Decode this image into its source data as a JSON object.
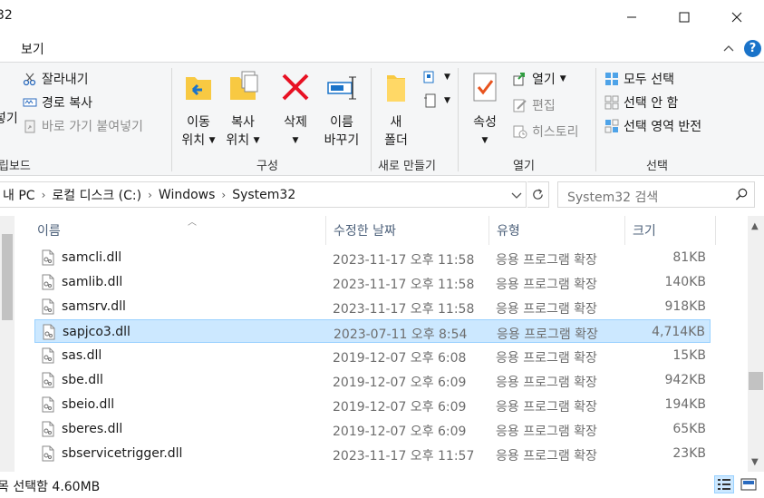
{
  "window": {
    "title": "32",
    "minimize_glyph": "—",
    "maximize_glyph": "☐",
    "close_glyph": "✕"
  },
  "ribbon_tabs": {
    "view_label": "보기",
    "help_glyph": "?"
  },
  "ribbon": {
    "clipboard": {
      "partial_label_left": "넣기",
      "cut_label": "잘라내기",
      "copy_path_label": "경로 복사",
      "paste_shortcut_label": "바로 가기 붙여넣기",
      "group_label": "립보드"
    },
    "organize": {
      "move_to_line1": "이동",
      "move_to_line2": "위치",
      "copy_to_line1": "복사",
      "copy_to_line2": "위치",
      "delete_label": "삭제",
      "rename_line1": "이름",
      "rename_line2": "바꾸기",
      "group_label": "구성"
    },
    "new": {
      "new_folder_line1": "새",
      "new_folder_line2": "폴더",
      "group_label": "새로 만들기"
    },
    "open": {
      "properties_label": "속성",
      "open_label": "열기",
      "edit_label": "편집",
      "history_label": "히스토리",
      "group_label": "열기"
    },
    "select": {
      "select_all_label": "모두 선택",
      "select_none_label": "선택 안 함",
      "invert_selection_label": "선택 영역 반전",
      "group_label": "선택"
    }
  },
  "address_bar": {
    "breadcrumbs": [
      "내 PC",
      "로컬 디스크 (C:)",
      "Windows",
      "System32"
    ],
    "search_placeholder": "System32 검색"
  },
  "file_list": {
    "columns": {
      "name": "이름",
      "date": "수정한 날짜",
      "type": "유형",
      "size": "크기"
    },
    "rows": [
      {
        "name": "samcli.dll",
        "date": "2023-11-17 오후 11:58",
        "type": "응용 프로그램 확장",
        "size": "81KB"
      },
      {
        "name": "samlib.dll",
        "date": "2023-11-17 오후 11:58",
        "type": "응용 프로그램 확장",
        "size": "140KB"
      },
      {
        "name": "samsrv.dll",
        "date": "2023-11-17 오후 11:58",
        "type": "응용 프로그램 확장",
        "size": "918KB"
      },
      {
        "name": "sapjco3.dll",
        "date": "2023-07-11 오후 8:54",
        "type": "응용 프로그램 확장",
        "size": "4,714KB"
      },
      {
        "name": "sas.dll",
        "date": "2019-12-07 오후 6:08",
        "type": "응용 프로그램 확장",
        "size": "15KB"
      },
      {
        "name": "sbe.dll",
        "date": "2019-12-07 오후 6:09",
        "type": "응용 프로그램 확장",
        "size": "942KB"
      },
      {
        "name": "sbeio.dll",
        "date": "2019-12-07 오후 6:09",
        "type": "응용 프로그램 확장",
        "size": "194KB"
      },
      {
        "name": "sberes.dll",
        "date": "2019-12-07 오후 6:09",
        "type": "응용 프로그램 확장",
        "size": "65KB"
      },
      {
        "name": "sbservicetrigger.dll",
        "date": "2023-11-17 오후 11:57",
        "type": "응용 프로그램 확장",
        "size": "23KB"
      }
    ],
    "selected_index": 3
  },
  "status_bar": {
    "selection_text": "목 선택함 4.60MB"
  },
  "colors": {
    "selection_bg": "#cce8ff",
    "selection_border": "#99d1ff",
    "delete_red": "#e81123",
    "folder_yellow": "#f8c942",
    "accent_blue": "#1a73c9"
  }
}
